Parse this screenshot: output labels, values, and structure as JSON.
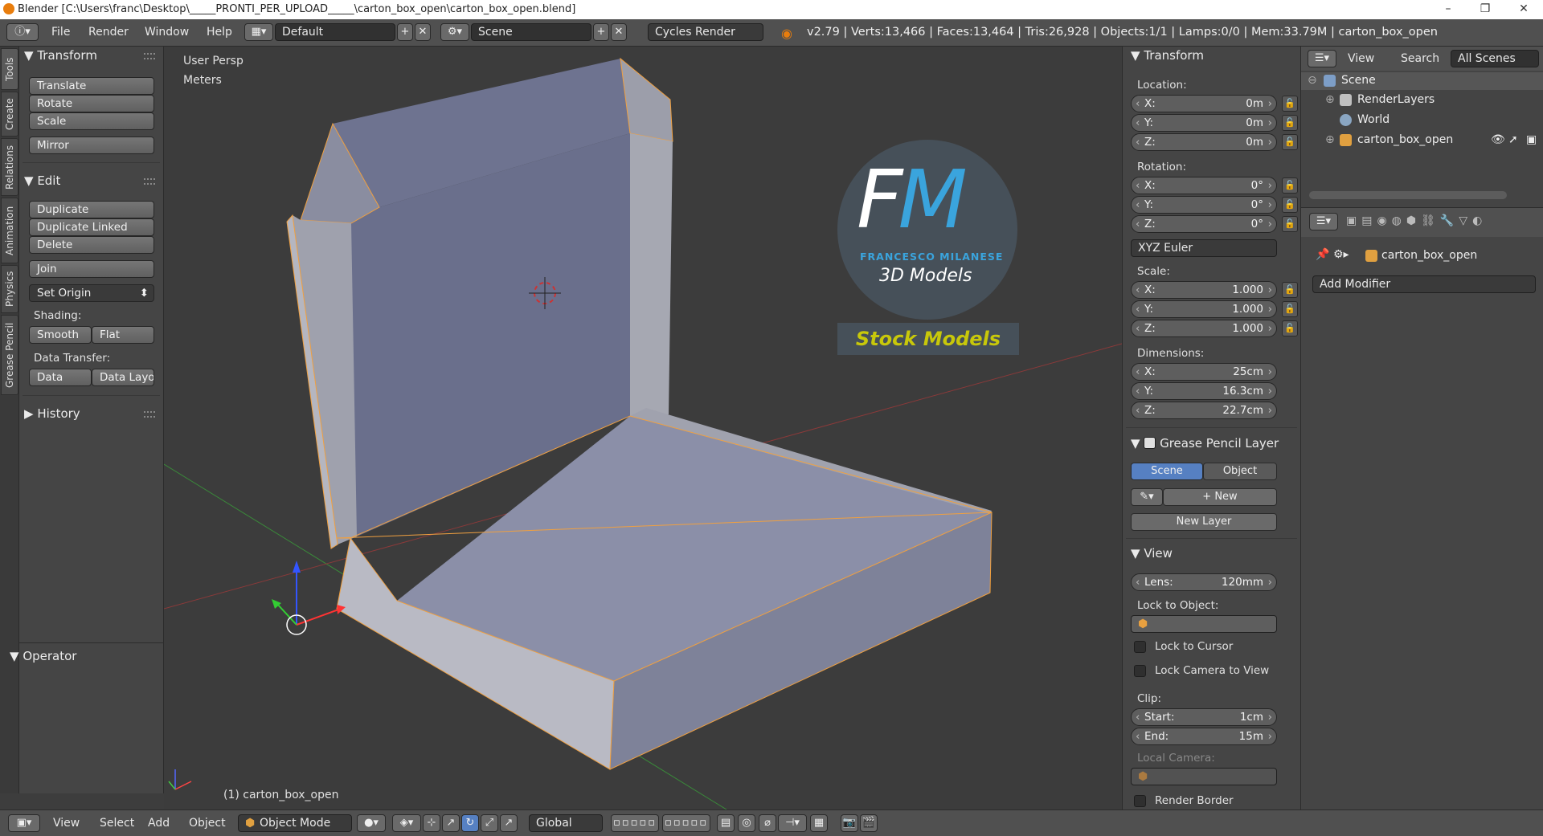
{
  "window": {
    "title": "Blender  [C:\\Users\\franc\\Desktop\\_____PRONTI_PER_UPLOAD_____\\carton_box_open\\carton_box_open.blend]"
  },
  "menu": [
    "File",
    "Render",
    "Window",
    "Help"
  ],
  "header": {
    "layout": "Default",
    "scene": "Scene",
    "engine": "Cycles Render",
    "stats": "v2.79 | Verts:13,466 | Faces:13,464 | Tris:26,928 | Objects:1/1 | Lamps:0/0 | Mem:33.79M | carton_box_open"
  },
  "sidetabs": [
    "Tools",
    "Create",
    "Relations",
    "Animation",
    "Physics",
    "Grease Pencil"
  ],
  "tools": {
    "transform": {
      "title": "Transform",
      "buttons": [
        "Translate",
        "Rotate",
        "Scale",
        "Mirror"
      ]
    },
    "edit": {
      "title": "Edit",
      "buttons": [
        "Duplicate",
        "Duplicate Linked",
        "Delete",
        "Join"
      ],
      "set_origin": "Set Origin",
      "shading_label": "Shading:",
      "smooth": "Smooth",
      "flat": "Flat",
      "transfer_label": "Data Transfer:",
      "data": "Data",
      "data_layo": "Data Layo"
    },
    "history": "History",
    "operator": "Operator"
  },
  "viewport": {
    "view_name": "User Persp",
    "units": "Meters",
    "object_label": "(1) carton_box_open",
    "logo": {
      "letters": "FM",
      "name": "FRANCESCO MILANESE",
      "sub": "3D Models",
      "banner": "Stock Models"
    }
  },
  "props": {
    "transform_title": "Transform",
    "location_label": "Location:",
    "location": [
      {
        "k": "X:",
        "v": "0m"
      },
      {
        "k": "Y:",
        "v": "0m"
      },
      {
        "k": "Z:",
        "v": "0m"
      }
    ],
    "rotation_label": "Rotation:",
    "rotation": [
      {
        "k": "X:",
        "v": "0°"
      },
      {
        "k": "Y:",
        "v": "0°"
      },
      {
        "k": "Z:",
        "v": "0°"
      }
    ],
    "rotation_mode": "XYZ Euler",
    "scale_label": "Scale:",
    "scale": [
      {
        "k": "X:",
        "v": "1.000"
      },
      {
        "k": "Y:",
        "v": "1.000"
      },
      {
        "k": "Z:",
        "v": "1.000"
      }
    ],
    "dimensions_label": "Dimensions:",
    "dimensions": [
      {
        "k": "X:",
        "v": "25cm"
      },
      {
        "k": "Y:",
        "v": "16.3cm"
      },
      {
        "k": "Z:",
        "v": "22.7cm"
      }
    ],
    "gp_title": "Grease Pencil Layer",
    "gp_scene": "Scene",
    "gp_object": "Object",
    "gp_new": "New",
    "gp_new_layer": "New Layer",
    "view_title": "View",
    "lens": {
      "k": "Lens:",
      "v": "120mm"
    },
    "lock_obj_label": "Lock to Object:",
    "lock_cursor": "Lock to Cursor",
    "lock_camera": "Lock Camera to View",
    "clip_label": "Clip:",
    "clip_start": {
      "k": "Start:",
      "v": "1cm"
    },
    "clip_end": {
      "k": "End:",
      "v": "15m"
    },
    "local_camera": "Local Camera:",
    "render_border": "Render Border"
  },
  "outliner": {
    "view": "View",
    "search": "Search",
    "scenes": "All Scenes",
    "items": [
      "Scene",
      "RenderLayers",
      "World",
      "carton_box_open"
    ]
  },
  "propeditor": {
    "object": "carton_box_open",
    "add_modifier": "Add Modifier"
  },
  "bottom": {
    "menu": [
      "View",
      "Select",
      "Add",
      "Object"
    ],
    "mode": "Object Mode",
    "orientation": "Global"
  },
  "colors": {
    "accent": "#5680c2",
    "selection": "#f0a040",
    "box": "#8a8fa8"
  }
}
